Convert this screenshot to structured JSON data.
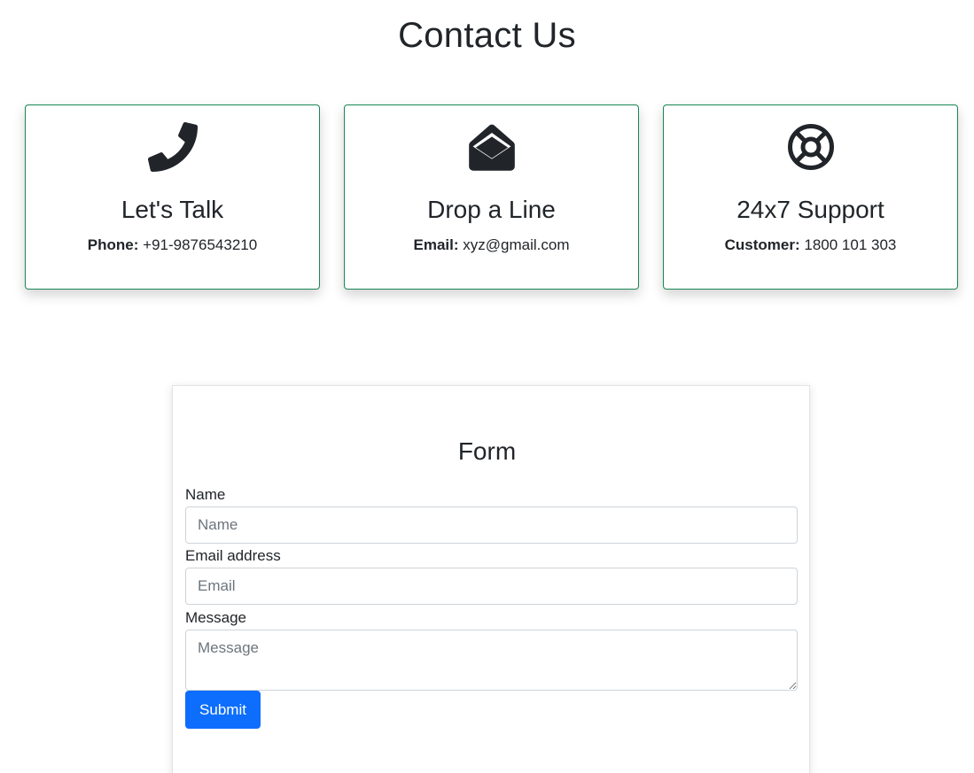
{
  "header": {
    "title": "Contact Us"
  },
  "cards": [
    {
      "icon": "phone-icon",
      "title": "Let's Talk",
      "label": "Phone:",
      "value": "+91-9876543210"
    },
    {
      "icon": "envelope-open-icon",
      "title": "Drop a Line",
      "label": "Email:",
      "value": "xyz@gmail.com"
    },
    {
      "icon": "life-ring-icon",
      "title": "24x7 Support",
      "label": "Customer:",
      "value": "1800 101 303"
    }
  ],
  "form": {
    "title": "Form",
    "name_label": "Name",
    "name_placeholder": "Name",
    "email_label": "Email address",
    "email_placeholder": "Email",
    "message_label": "Message",
    "message_placeholder": "Message",
    "submit_label": "Submit"
  },
  "colors": {
    "card_border": "#198754",
    "button": "#0d6efd",
    "text": "#212529"
  }
}
